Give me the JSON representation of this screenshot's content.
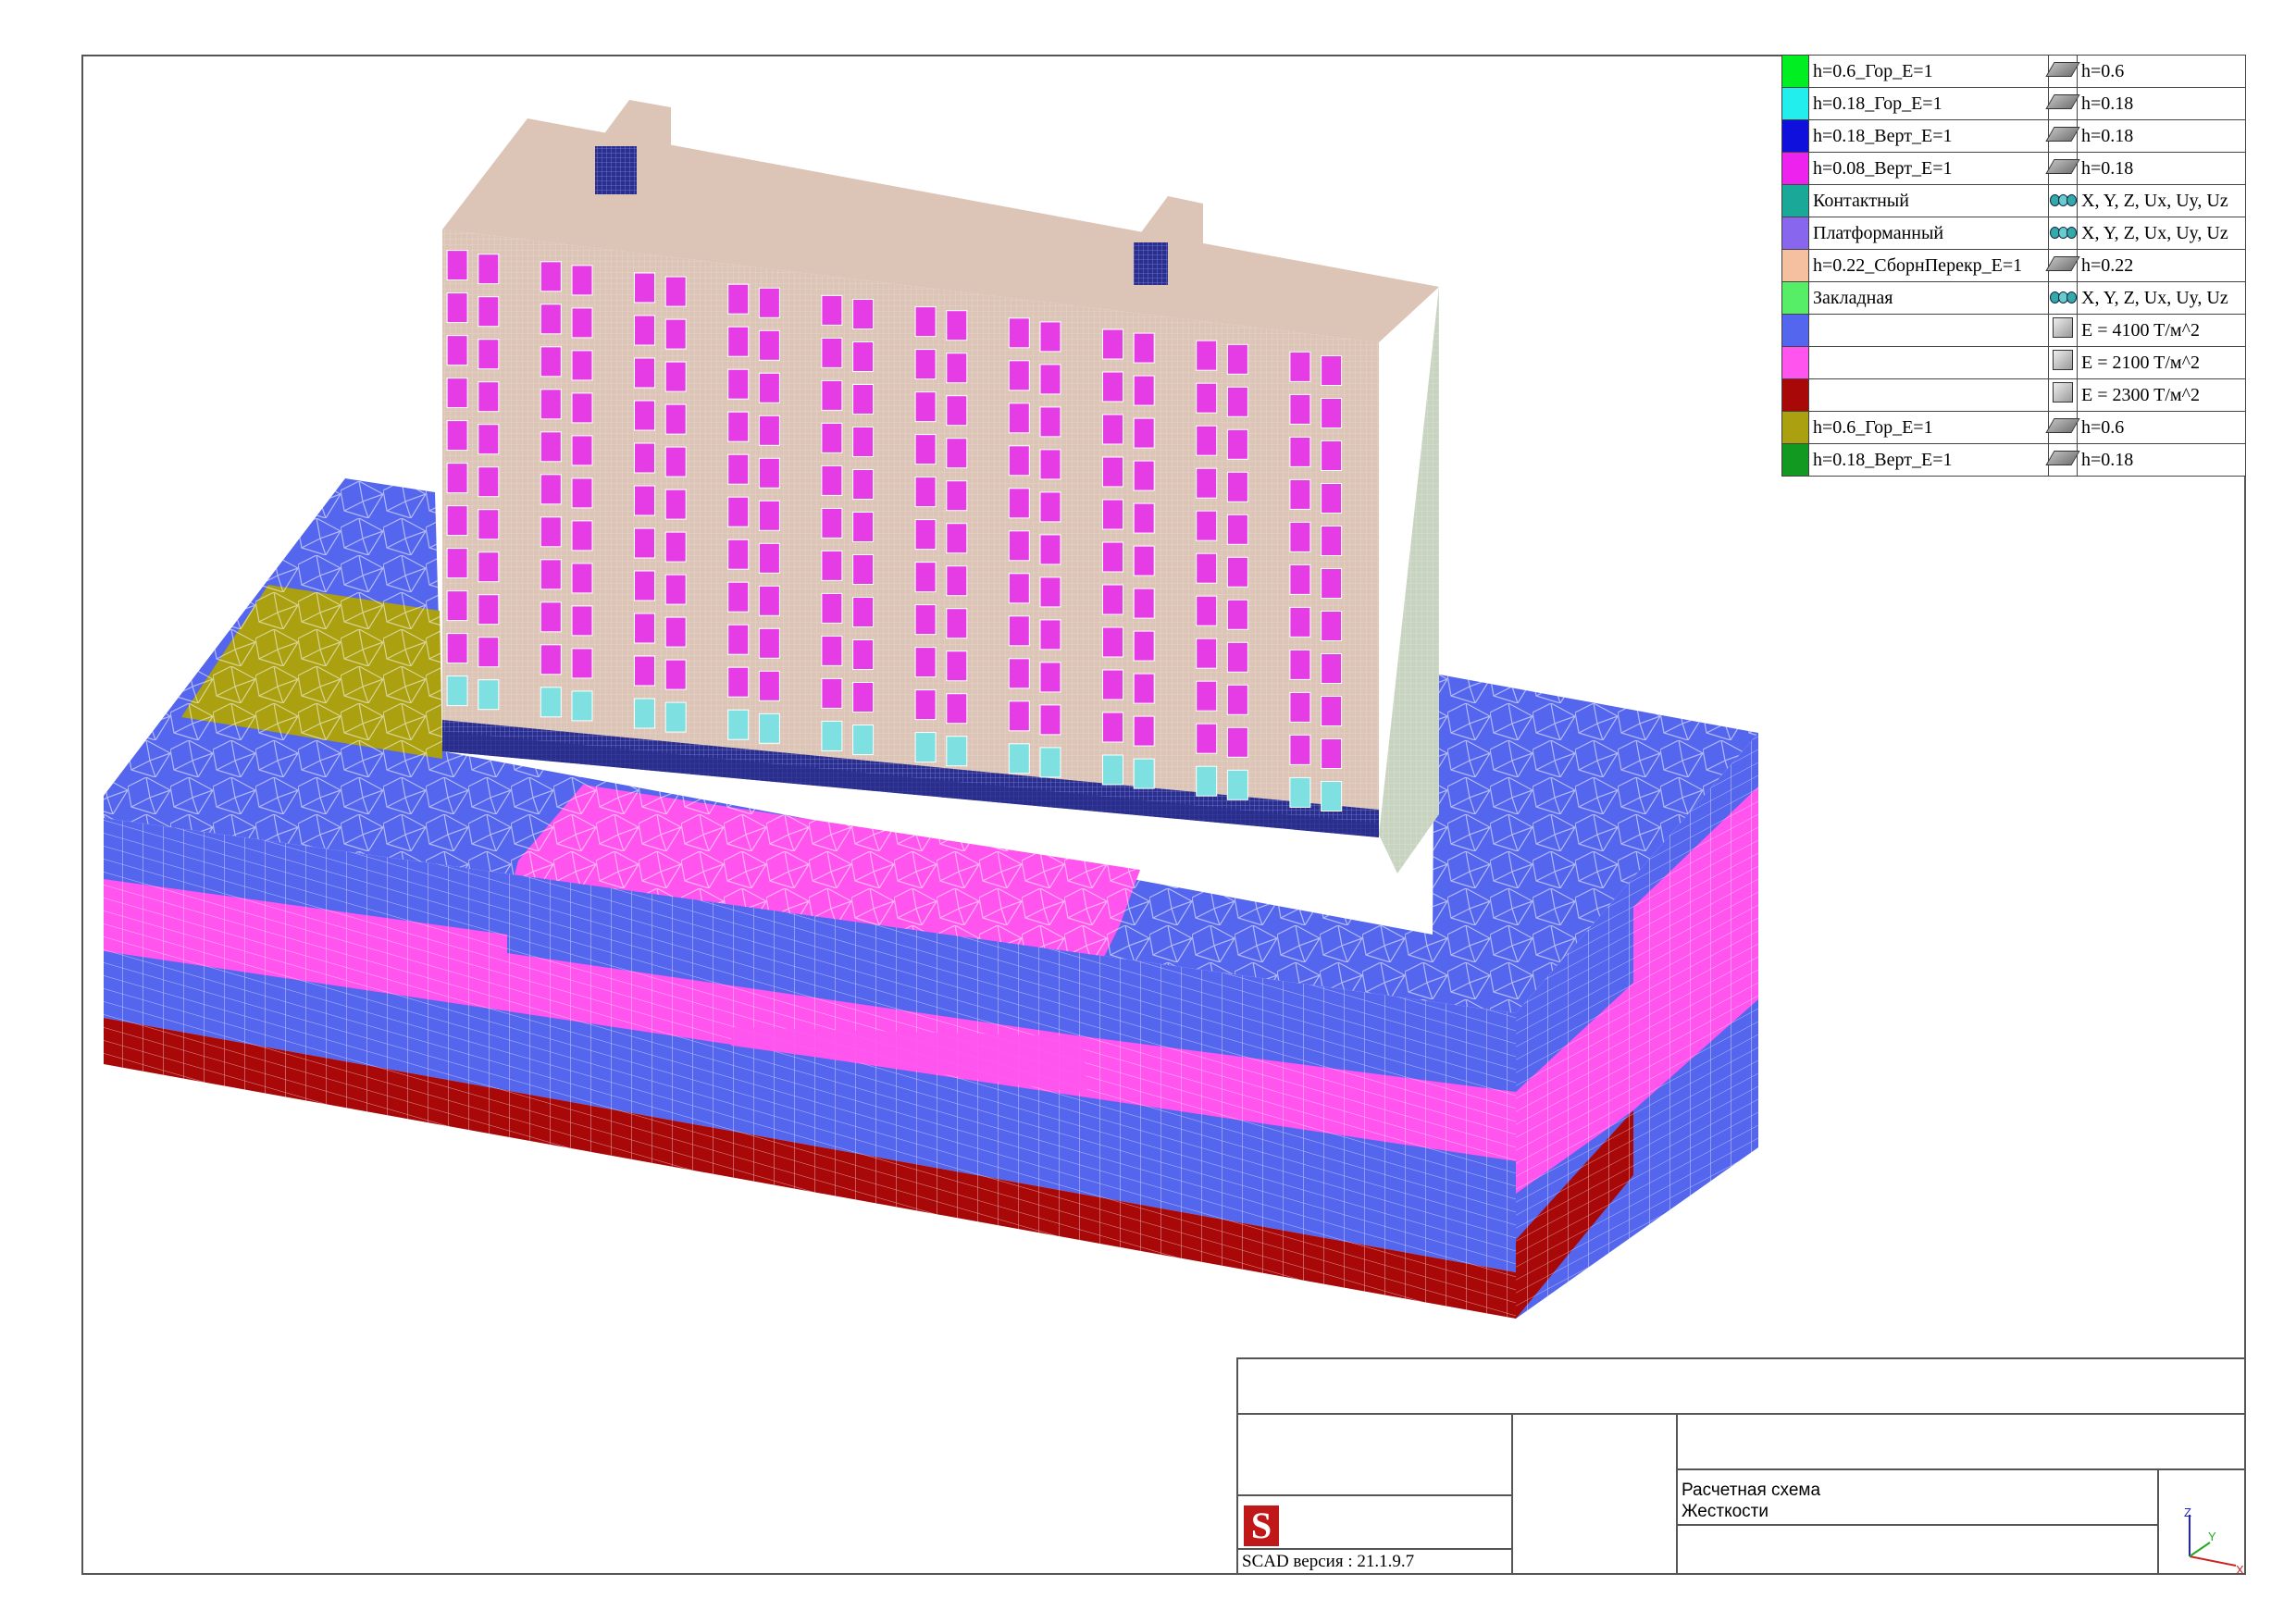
{
  "legend": [
    {
      "color": "#00ee22",
      "name": "h=0.6_Гор_E=1",
      "icon": "plate-icon",
      "value": "h=0.6"
    },
    {
      "color": "#22eeee",
      "name": "h=0.18_Гор_E=1",
      "icon": "plate-icon",
      "value": "h=0.18"
    },
    {
      "color": "#1010dd",
      "name": "h=0.18_Верт_E=1",
      "icon": "plate-icon",
      "value": "h=0.18"
    },
    {
      "color": "#ee22ee",
      "name": "h=0.08_Верт_E=1",
      "icon": "plate-icon",
      "value": "h=0.18"
    },
    {
      "color": "#1aa898",
      "name": "Контактный",
      "icon": "link-icon",
      "value": "X, Y, Z, Ux, Uy, Uz"
    },
    {
      "color": "#8866ee",
      "name": "Платформанный",
      "icon": "link-icon",
      "value": "X, Y, Z, Ux, Uy, Uz"
    },
    {
      "color": "#f4c0a0",
      "name": "h=0.22_СборнПерекр_E=1",
      "icon": "plate-icon",
      "value": "h=0.22"
    },
    {
      "color": "#55ee66",
      "name": "Закладная",
      "icon": "link-icon",
      "value": "X, Y, Z, Ux, Uy, Uz"
    },
    {
      "color": "#5566ee",
      "name": "",
      "icon": "solid-icon",
      "value": "E = 4100 T/м^2"
    },
    {
      "color": "#ff55ee",
      "name": "",
      "icon": "solid-icon",
      "value": "E = 2100 T/м^2"
    },
    {
      "color": "#a80808",
      "name": "",
      "icon": "solid-icon",
      "value": "E = 2300 T/м^2"
    },
    {
      "color": "#aaa010",
      "name": "h=0.6_Гор_E=1",
      "icon": "plate-icon",
      "value": "h=0.6"
    },
    {
      "color": "#119922",
      "name": "h=0.18_Верт_E=1",
      "icon": "plate-icon",
      "value": "h=0.18"
    }
  ],
  "stamp": {
    "version": "SCAD версия : 21.1.9.7",
    "logo_letter": "S",
    "scheme_label": "Расчетная схема",
    "mode_label": "Жесткости",
    "axis_x": "X",
    "axis_y": "Y",
    "axis_z": "Z"
  },
  "colors": {
    "soil_blue": "#5566ee",
    "soil_pink": "#ff55ee",
    "soil_red": "#a80808",
    "slab_olive": "#aaa010",
    "building_beige": "#dcc4b6",
    "window_magenta": "#e63ce6",
    "base_cyan": "#7ee0e0",
    "base_navy": "#2a2e8c"
  }
}
